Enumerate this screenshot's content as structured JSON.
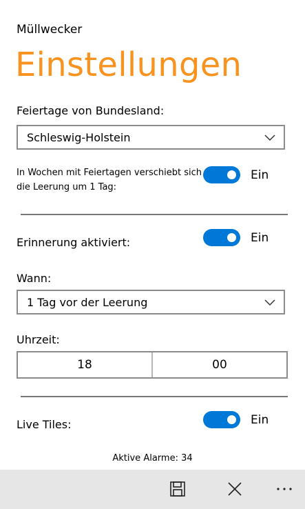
{
  "app": {
    "name": "Müllwecker"
  },
  "page": {
    "title": "Einstellungen"
  },
  "holidays": {
    "label": "Feiertage von Bundesland:",
    "selected": "Schleswig-Holstein",
    "shift_text_line1": "In Wochen mit Feiertagen verschiebt sich",
    "shift_text_line2": "die Leerung um 1 Tag:",
    "shift_toggle_state": "Ein"
  },
  "reminder": {
    "label": "Erinnerung aktiviert:",
    "toggle_state": "Ein",
    "when_label": "Wann:",
    "when_selected": "1 Tag vor der Leerung",
    "time_label": "Uhrzeit:",
    "hour": "18",
    "minute": "00"
  },
  "live_tiles": {
    "label": "Live Tiles:",
    "toggle_state": "Ein"
  },
  "status": {
    "active_alarms": "Aktive Alarme: 34"
  },
  "appbar": {
    "icons": [
      "save-icon",
      "close-icon",
      "more-icon"
    ]
  },
  "colors": {
    "accent": "#f7931e",
    "toggle_on": "#0078d7",
    "appbar_bg": "#e6e6e6"
  }
}
